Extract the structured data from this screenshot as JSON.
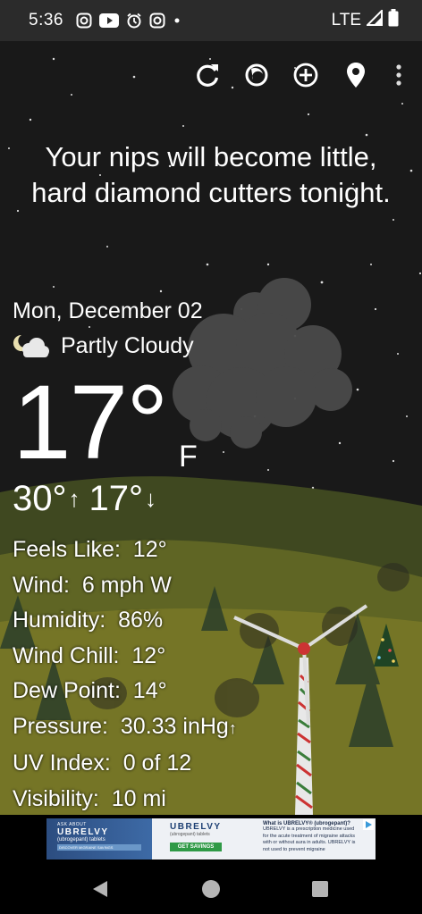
{
  "status": {
    "time": "5:36",
    "network": "LTE"
  },
  "toolbar": {
    "icons": [
      "refresh-icon",
      "weather-toggle-icon",
      "add-location-icon",
      "location-pin-icon",
      "more-vert-icon"
    ]
  },
  "message": "Your nips will become little, hard diamond cutters tonight.",
  "weather": {
    "date": "Mon, December 02",
    "condition": "Partly Cloudy",
    "temp": "17°",
    "unit": "F",
    "high": "30°",
    "low": "17°",
    "details": [
      {
        "label": "Feels Like:",
        "value": "12°"
      },
      {
        "label": "Wind:",
        "value": "6 mph W"
      },
      {
        "label": "Humidity:",
        "value": "86%"
      },
      {
        "label": "Wind Chill:",
        "value": "12°"
      },
      {
        "label": "Dew Point:",
        "value": "14°"
      },
      {
        "label": "Pressure:",
        "value": "30.33 inHg"
      },
      {
        "label": "UV Index:",
        "value": "0 of 12"
      },
      {
        "label": "Visibility:",
        "value": "10 mi"
      }
    ]
  },
  "ad": {
    "tag": "ASK ABOUT",
    "brand": "UBRELVY",
    "subbrand": "(ubrogepant) tablets",
    "cta_small": "DISCOVER MIGRAINE SAVINGS",
    "cta": "GET SAVINGS",
    "copy_title": "What is UBRELVY® (ubrogepant)?",
    "copy": "UBRELVY is a prescription medicine used for the acute treatment of migraine attacks with or without aura in adults. UBRELVY is not used to prevent migraine"
  },
  "colors": {
    "sky": "#191919",
    "field": "#6b6b22",
    "text": "#ffffff",
    "ad_blue": "#1c3f73"
  }
}
